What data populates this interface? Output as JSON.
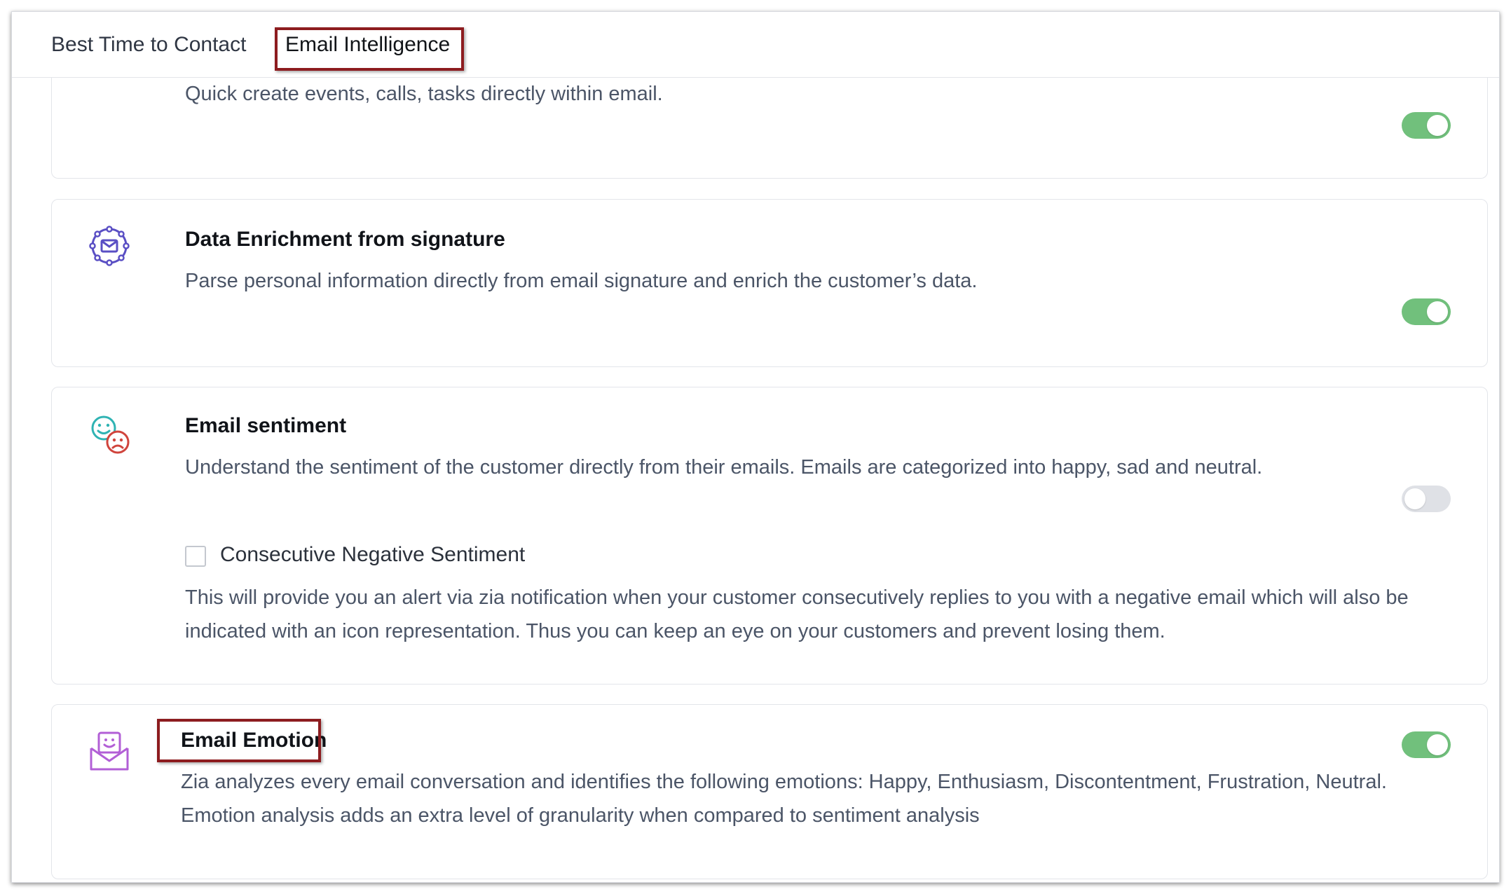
{
  "tabs": [
    {
      "label": "Best Time to Contact"
    },
    {
      "label": "Email Intelligence"
    }
  ],
  "cards": {
    "quick_create": {
      "description": "Quick create events, calls, tasks directly within email.",
      "enabled": true
    },
    "data_enrichment": {
      "icon": "signature-envelope-icon",
      "title": "Data Enrichment from signature",
      "description": "Parse personal information directly from email signature and enrich the customer’s data.",
      "enabled": true
    },
    "email_sentiment": {
      "icon": "happy-sad-faces-icon",
      "title": "Email sentiment",
      "description": "Understand the sentiment of the customer directly from their emails. Emails are categorized into happy, sad and neutral.",
      "enabled": false,
      "sub_option": {
        "label": "Consecutive Negative Sentiment",
        "checked": false,
        "description": "This will provide you an alert via zia notification when your customer consecutively replies to you with a negative email which will also be indicated with an icon representation. Thus you can keep an eye on your customers and prevent losing them."
      }
    },
    "email_emotion": {
      "icon": "smiling-envelope-icon",
      "title": "Email Emotion",
      "description": "Zia analyzes every email conversation and identifies the following emotions: Happy, Enthusiasm, Discontentment, Frustration, Neutral. Emotion analysis adds an extra level of granularity when compared to sentiment analysis",
      "enabled": true
    }
  },
  "colors": {
    "toggle_on": "#71c07c",
    "toggle_off": "#dfe1e6",
    "highlight_box": "#8d1c1f"
  }
}
